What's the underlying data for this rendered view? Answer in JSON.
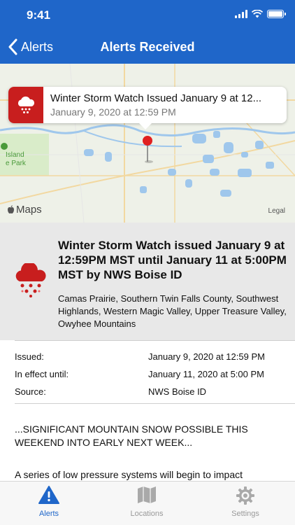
{
  "status_bar": {
    "time": "9:41"
  },
  "nav": {
    "back_label": "Alerts",
    "title": "Alerts Received"
  },
  "map": {
    "callout_title": "Winter Storm Watch Issued January 9 at 12...",
    "callout_subtitle": "January 9, 2020 at 12:59 PM",
    "maps_label": "Maps",
    "legal_label": "Legal",
    "place_label_1": "Island",
    "place_label_2": "e Park"
  },
  "alert": {
    "title": "Winter Storm Watch issued January 9 at 12:59PM MST until January 11 at 5:00PM MST by NWS Boise ID",
    "areas": "Camas Prairie, Southern Twin Falls County, Southwest Highlands, Western Magic Valley, Upper Treasure Valley, Owyhee Mountains"
  },
  "details": {
    "issued_label": "Issued:",
    "issued_value": "January 9, 2020 at 12:59 PM",
    "effect_label": "In effect until:",
    "effect_value": "January 11, 2020 at 5:00 PM",
    "source_label": "Source:",
    "source_value": "NWS Boise ID"
  },
  "body": {
    "headline": "...SIGNIFICANT MOUNTAIN SNOW POSSIBLE THIS WEEKEND INTO EARLY NEXT WEEK...",
    "paragraph": "A series of low pressure systems will begin to impact"
  },
  "tabs": [
    {
      "label": "Alerts",
      "icon": "warning-triangle-icon"
    },
    {
      "label": "Locations",
      "icon": "map-icon"
    },
    {
      "label": "Settings",
      "icon": "gear-icon"
    }
  ],
  "colors": {
    "header": "#1f66c9",
    "alert_red": "#c81e1e",
    "active_tab": "#1f66c9"
  }
}
